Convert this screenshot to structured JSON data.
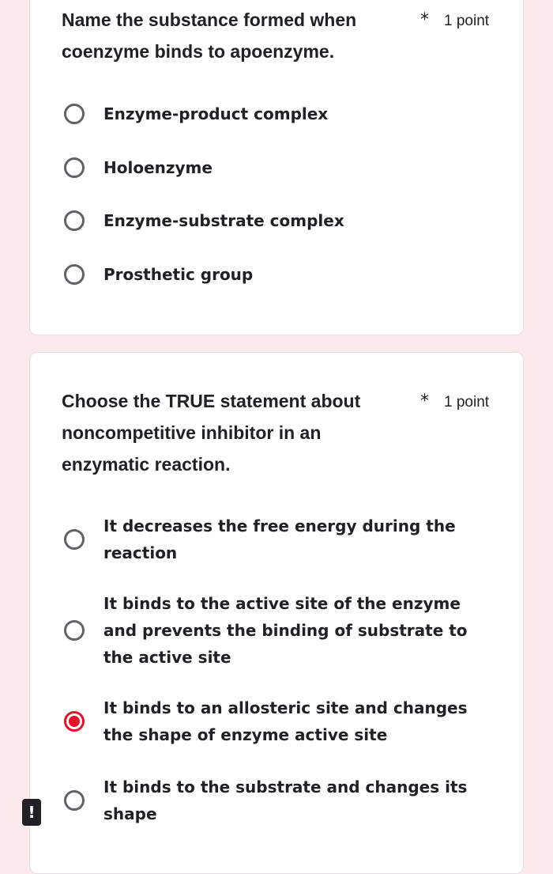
{
  "questions": [
    {
      "title": "Name the substance formed when coenzyme binds to apoenzyme.",
      "required_mark": "*",
      "points": "1 point",
      "options": [
        {
          "label": "Enzyme-product complex",
          "selected": false
        },
        {
          "label": "Holoenzyme",
          "selected": false
        },
        {
          "label": "Enzyme-substrate complex",
          "selected": false
        },
        {
          "label": "Prosthetic group",
          "selected": false
        }
      ]
    },
    {
      "title": "Choose the TRUE statement about noncompetitive inhibitor in an enzymatic reaction.",
      "required_mark": "*",
      "points": "1 point",
      "options": [
        {
          "label": "It decreases the free energy during the reaction",
          "selected": false
        },
        {
          "label": "It binds to the active site of the enzyme and prevents the binding of substrate to the active site",
          "selected": false
        },
        {
          "label": "It binds to an allosteric site and changes the shape of enzyme active site",
          "selected": true
        },
        {
          "label": "It binds to the substrate and changes its shape",
          "selected": false
        }
      ]
    }
  ],
  "warning_badge": "!",
  "colors": {
    "page_background": "#fbe9ec",
    "accent": "#e8102a",
    "text": "#202124",
    "radio_border": "#5f6368"
  }
}
